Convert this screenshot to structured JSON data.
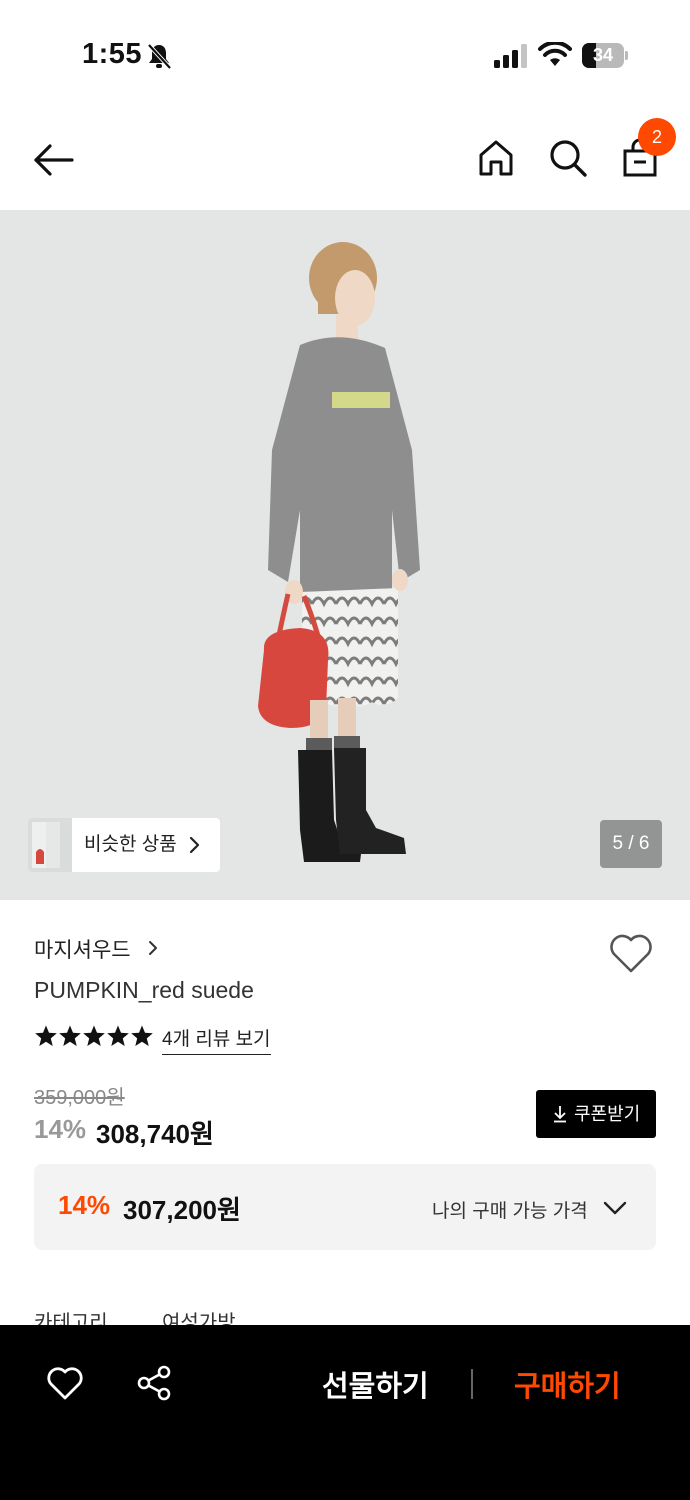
{
  "status_bar": {
    "time": "1:55",
    "battery": "34",
    "battery_level": 0.34
  },
  "header": {
    "cart_count": "2"
  },
  "gallery": {
    "similar_label": "비슷한 상품",
    "page_indicator": "5 / 6"
  },
  "product": {
    "brand": "마지셔우드",
    "name": "PUMPKIN_red suede",
    "rating": 5,
    "review_link": "4개 리뷰 보기",
    "original_price": "359,000원",
    "discount_rate": "14%",
    "sale_price": "308,740원",
    "coupon_label": "쿠폰받기"
  },
  "my_price": {
    "rate": "14%",
    "price": "307,200원",
    "label": "나의 구매 가능 가격"
  },
  "details": {
    "category_label": "카테고리",
    "category_value": "여성가방"
  },
  "bottom_bar": {
    "gift_label": "선물하기",
    "buy_label": "구매하기"
  },
  "colors": {
    "accent": "#ff4800",
    "background": "#ffffff",
    "bottom_bar": "#000000"
  }
}
